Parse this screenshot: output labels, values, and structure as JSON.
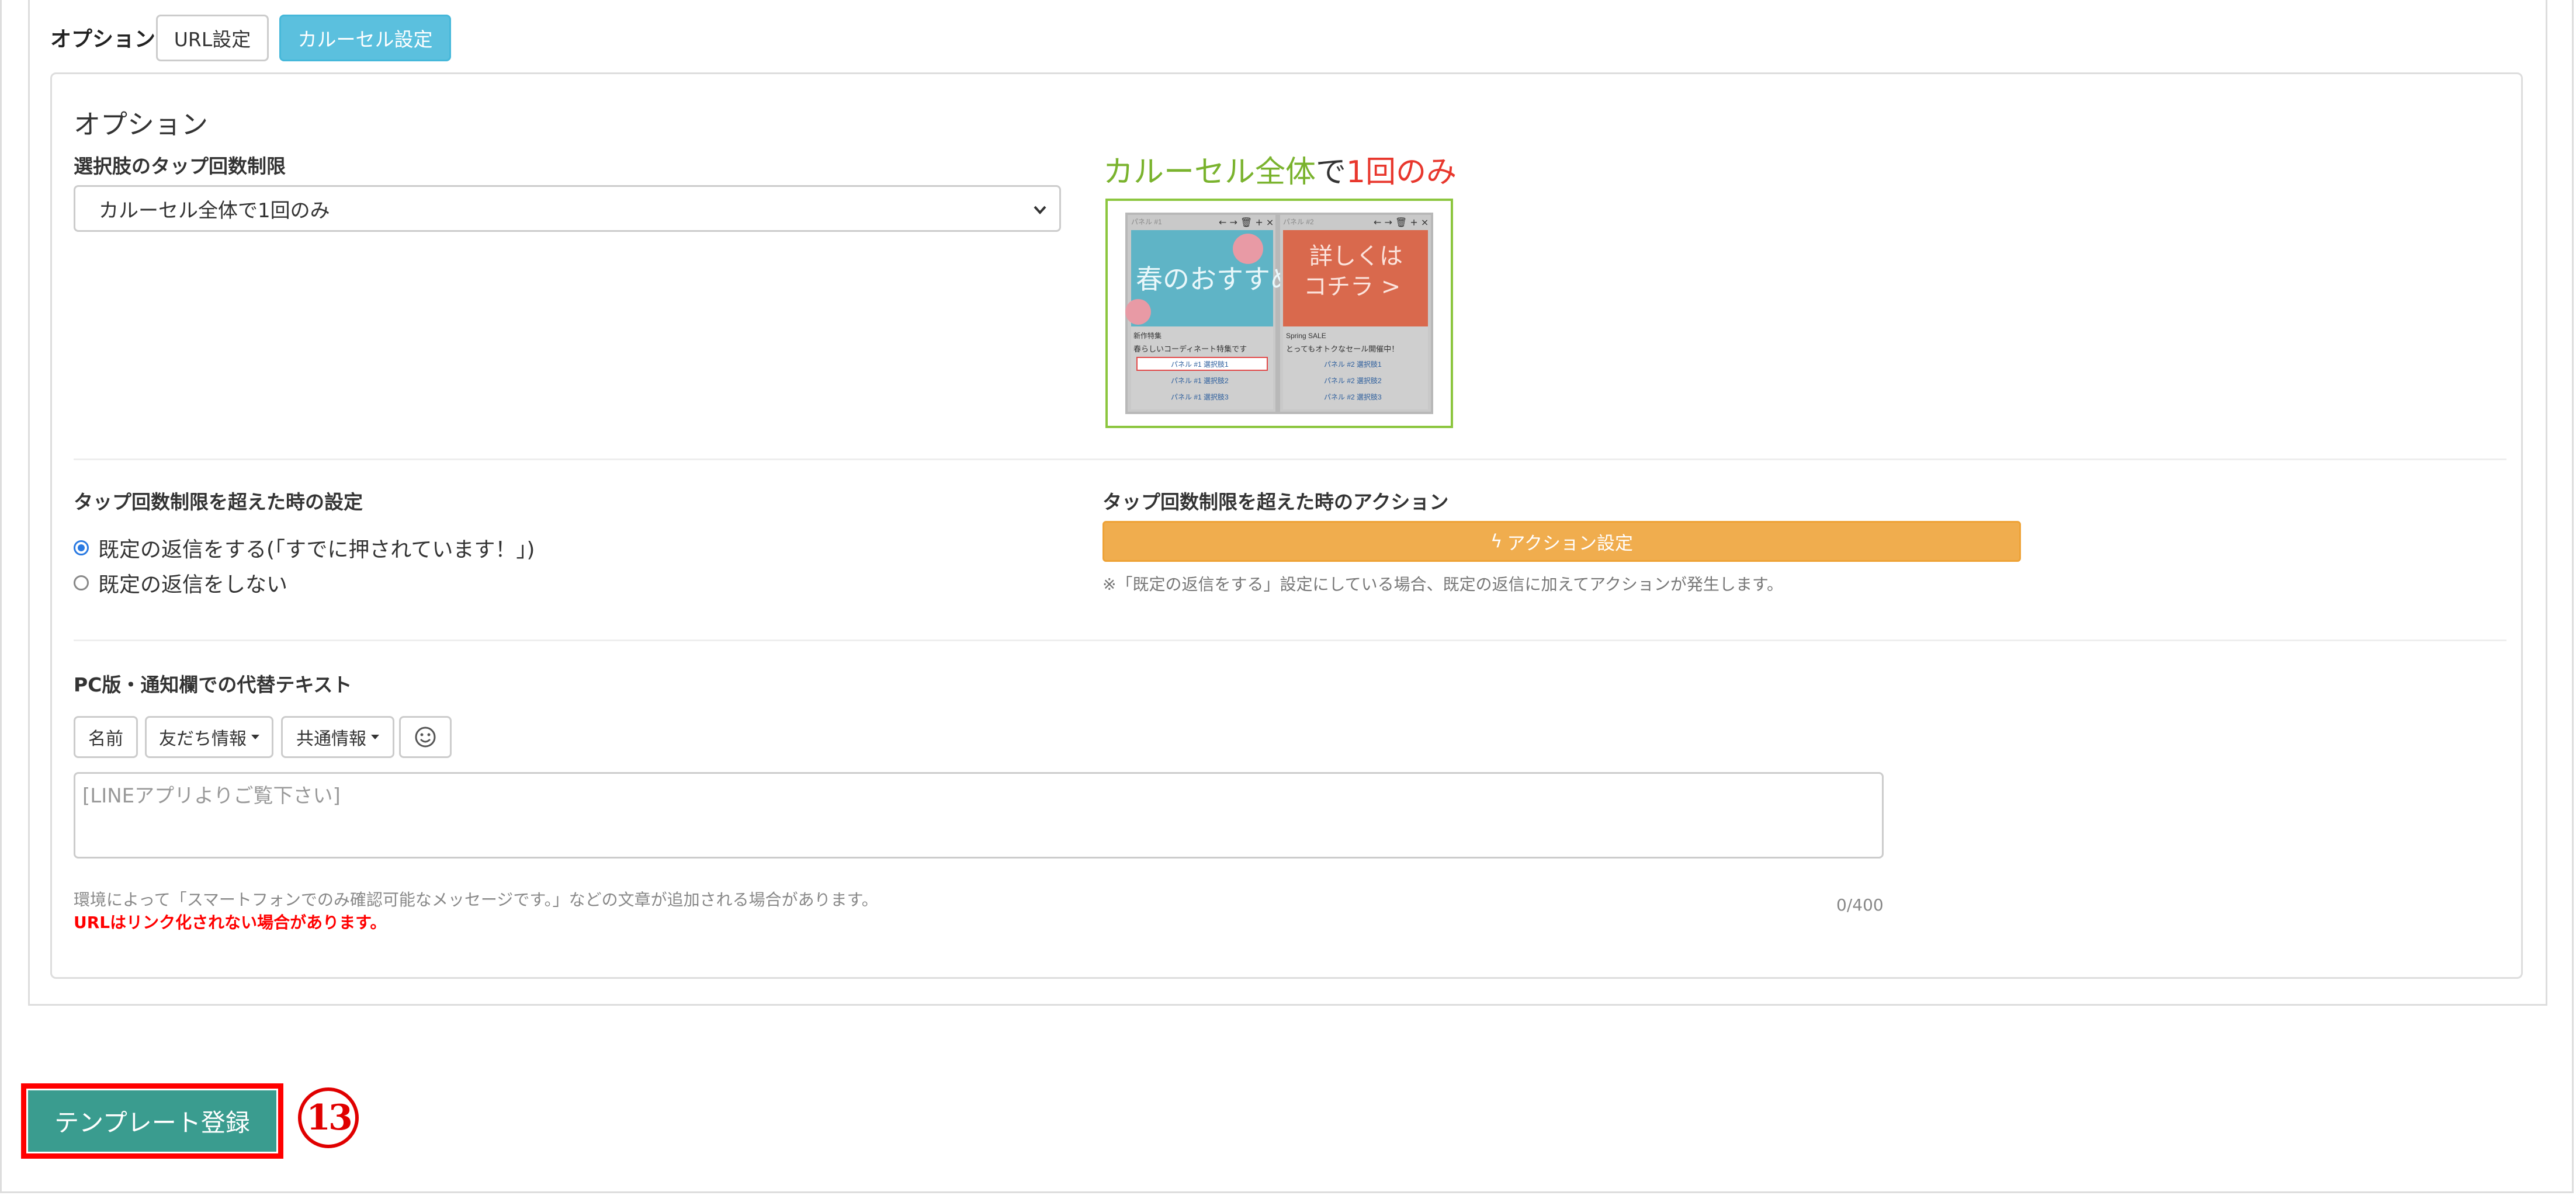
{
  "header": {
    "label": "オプション",
    "tabs": [
      {
        "label": "URL設定",
        "active": false
      },
      {
        "label": "カルーセル設定",
        "active": true
      }
    ]
  },
  "options": {
    "title": "オプション",
    "tap_limit": {
      "label": "選択肢のタップ回数制限",
      "selected": "カルーセル全体で1回のみ"
    },
    "preview": {
      "caption_main": "カルーセル全体",
      "caption_particle": "で",
      "caption_emphasis": "1回のみ",
      "panel1": {
        "header": "パネル #1",
        "image_text": "春のおすすめ",
        "title": "新作特集",
        "desc": "春らしいコーディネート特集です",
        "choices": [
          "パネル #1 選択肢1",
          "パネル #1 選択肢2",
          "パネル #1 選択肢3"
        ]
      },
      "panel2": {
        "header": "パネル #2",
        "image_text_line1": "詳しくは",
        "image_text_line2": "コチラ >",
        "title": "Spring SALE",
        "desc": "とってもオトクなセール開催中！",
        "choices": [
          "パネル #2 選択肢1",
          "パネル #2 選択肢2",
          "パネル #2 選択肢3"
        ]
      }
    },
    "exceed_setting": {
      "label": "タップ回数制限を超えた時の設定",
      "choices": [
        {
          "label": "既定の返信をする(「すでに押されています！」)",
          "checked": true
        },
        {
          "label": "既定の返信をしない",
          "checked": false
        }
      ]
    },
    "exceed_action": {
      "label": "タップ回数制限を超えた時のアクション",
      "button_label": "アクション設定",
      "note": "※「既定の返信をする」設定にしている場合、既定の返信に加えてアクションが発生します。"
    },
    "alt_text": {
      "label": "PC版・通知欄での代替テキスト",
      "tools": [
        "名前",
        "友だち情報",
        "共通情報"
      ],
      "placeholder": "[LINEアプリよりご覧下さい]",
      "counter": "0/400",
      "hint": "環境によって「スマートフォンでのみ確認可能なメッセージです。」などの文章が追加される場合があります。",
      "warning": "URLはリンク化されない場合があります。"
    }
  },
  "footer": {
    "register_label": "テンプレート登録",
    "step_marker": "13"
  },
  "colors": {
    "accent_info": "#5bc0de",
    "accent_warning": "#f0ad4e",
    "register": "#3a9c8f",
    "highlight": "#ff0000"
  }
}
